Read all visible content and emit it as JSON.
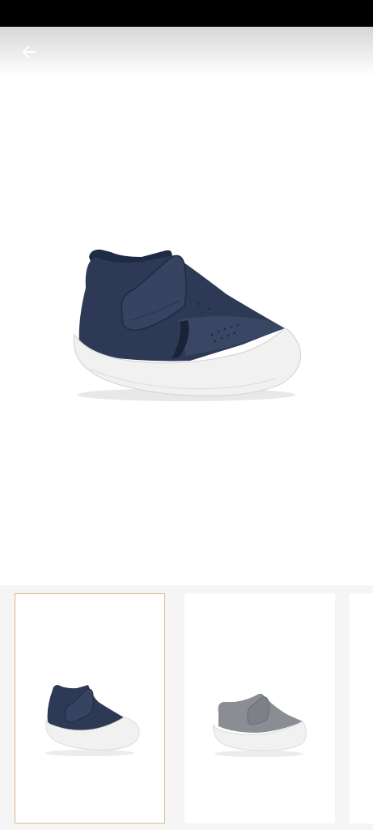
{
  "header": {
    "back_icon": "arrow-left-icon"
  },
  "colors": {
    "selected_border": "#d8b98a",
    "navy_shoe": "#2e3a55",
    "grey_shoe": "#8a8d94",
    "sole": "#f1f1f1"
  },
  "product": {
    "main_image": "navy-velcro-baby-shoe",
    "thumbnails": [
      {
        "image": "navy-velcro-baby-shoe",
        "selected": true
      },
      {
        "image": "grey-velcro-baby-shoe",
        "selected": false
      },
      {
        "image": "partial-thumbnail",
        "selected": false
      }
    ]
  }
}
